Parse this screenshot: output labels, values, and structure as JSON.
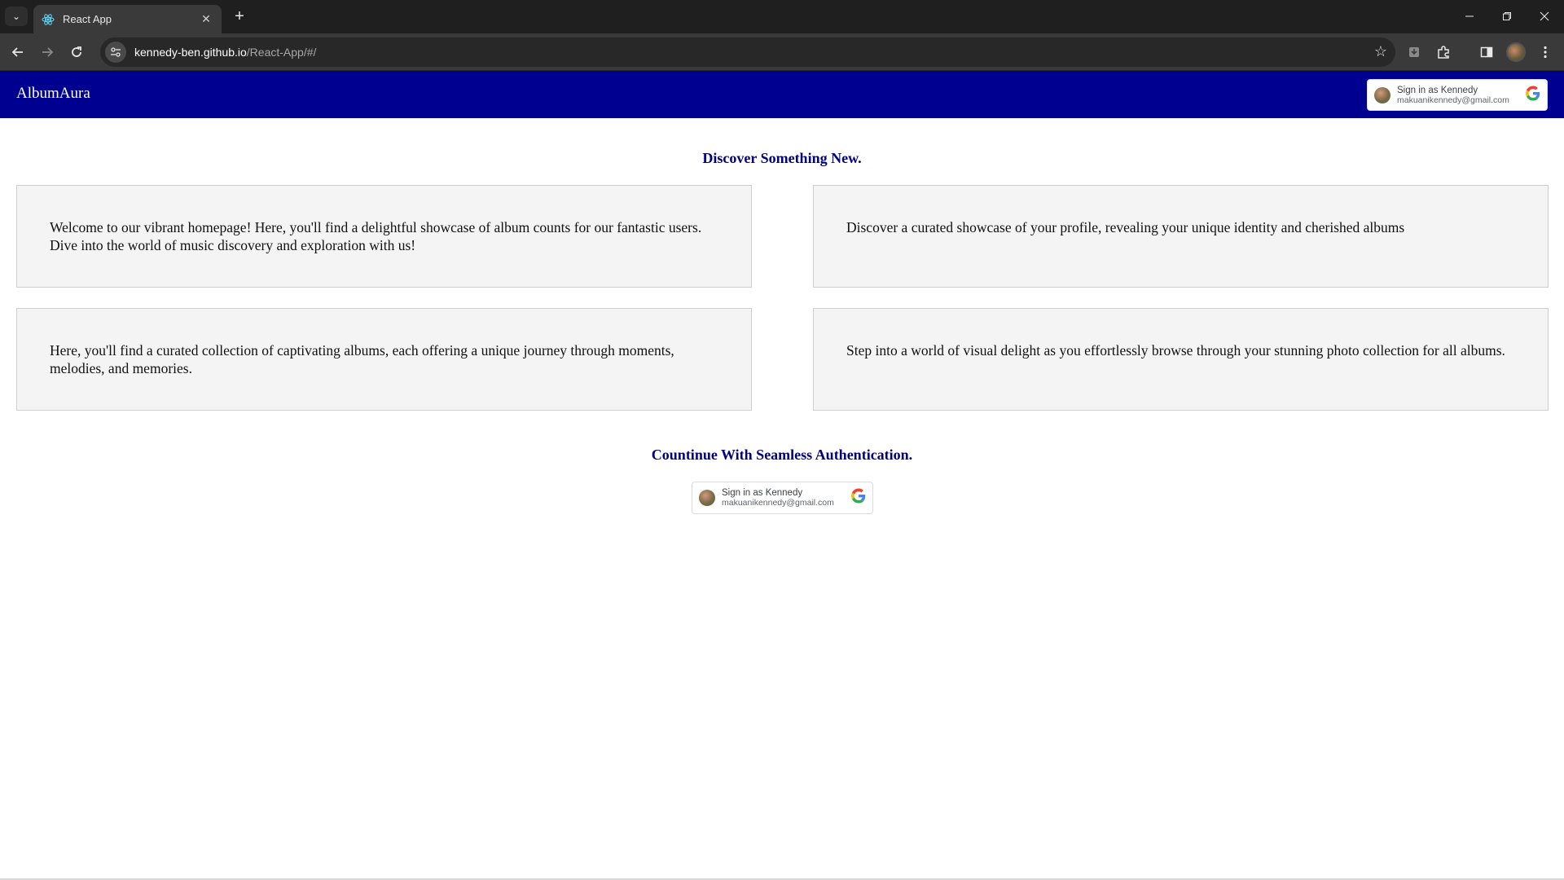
{
  "browser": {
    "tab": {
      "title": "React App",
      "favicon": "react-icon"
    },
    "url": {
      "host": "kennedy-ben.github.io",
      "path": "/React-App/#/"
    }
  },
  "app": {
    "brand": "AlbumAura",
    "nav_signin": {
      "label": "Sign in as Kennedy",
      "email": "makuanikennedy@gmail.com"
    },
    "discover_heading": "Discover Something New.",
    "cards": [
      {
        "text": "Welcome to our vibrant homepage! Here, you'll find a delightful showcase of album counts for our fantastic users. Dive into the world of music discovery and exploration with us!"
      },
      {
        "text": "Discover a curated showcase of your profile, revealing your unique identity and cherished albums"
      },
      {
        "text": "Here, you'll find a curated collection of captivating albums, each offering a unique journey through moments, melodies, and memories."
      },
      {
        "text": "Step into a world of visual delight as you effortlessly browse through your stunning photo collection for all albums."
      }
    ],
    "auth_heading": "Countinue With Seamless Authentication.",
    "signin": {
      "label": "Sign in as Kennedy",
      "email": "makuanikennedy@gmail.com"
    }
  },
  "colors": {
    "navbar": "#000090",
    "heading": "#000080",
    "card_bg": "#f4f4f4"
  }
}
